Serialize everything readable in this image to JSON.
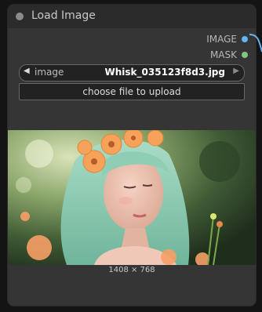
{
  "node": {
    "title": "Load Image",
    "outputs": [
      {
        "label": "IMAGE",
        "color": "#64b5f6"
      },
      {
        "label": "MASK",
        "color": "#81c784"
      }
    ],
    "image_widget": {
      "label": "image",
      "value": "Whisk_035123f8d3.jpg",
      "left_arrow": "◀",
      "right_arrow": "▶"
    },
    "upload_button": {
      "label": "choose file to upload"
    },
    "preview": {
      "alt": "Portrait of a woman with mint green wavy hair wearing an orange flower crown, among orange flowers",
      "dimensions": "1408 × 768"
    }
  },
  "colors": {
    "node_bg": "#353535",
    "title_bg": "#2b2b2b",
    "image_slot": "#64b5f6",
    "mask_slot": "#81c784"
  }
}
